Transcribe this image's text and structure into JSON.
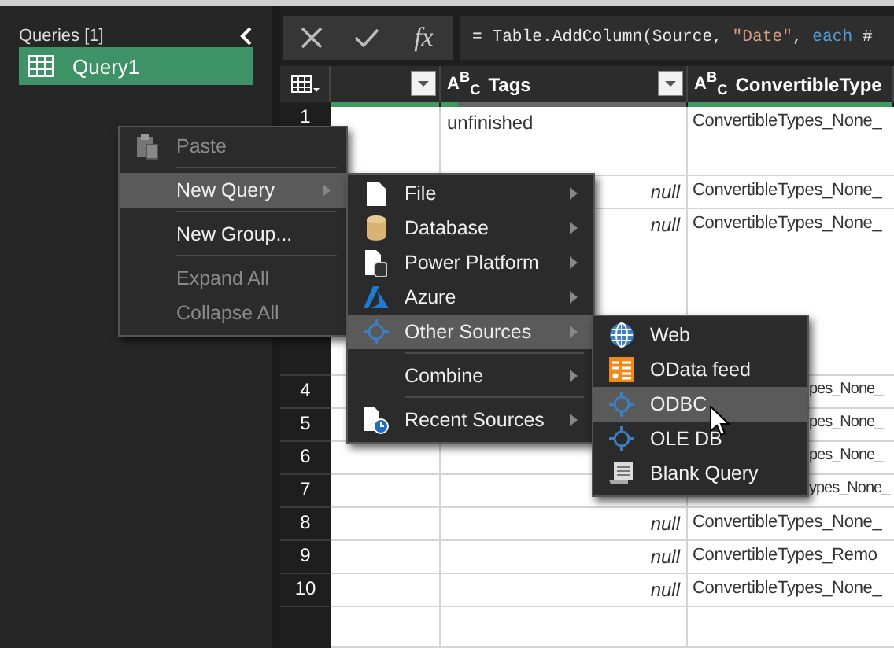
{
  "queries_pane": {
    "title": "Queries [1]",
    "items": [
      {
        "label": "Query1",
        "selected": true
      }
    ]
  },
  "formula_bar": {
    "buttons": [
      {
        "kind": "cancel"
      },
      {
        "kind": "commit"
      },
      {
        "kind": "function",
        "label": "fx"
      }
    ],
    "tokens": [
      {
        "kind": "plain",
        "text": "= Table.AddColumn(Source, "
      },
      {
        "kind": "string",
        "text": "\"Date\""
      },
      {
        "kind": "plain",
        "text": ", "
      },
      {
        "kind": "keyword",
        "text": "each"
      },
      {
        "kind": "plain",
        "text": " #"
      }
    ]
  },
  "table": {
    "columns": [
      {
        "level": 1
      },
      {
        "label": "Tags",
        "type_label": "A$^{B}$$_{C}$",
        "level": 0.07
      },
      {
        "label": "ConvertibleType",
        "type_label": "A$^{B}$$_{C}$",
        "level": 1
      }
    ],
    "rows": [
      {
        "number": "1",
        "tags": "unfinished",
        "tags_is_null": false,
        "convertible": "ConvertibleTypes_None_",
        "partly_hidden": false
      },
      {
        "tags": "null",
        "tags_is_null": true,
        "convertible": "ConvertibleTypes_None_",
        "partly_hidden": false
      },
      {
        "tags": "null",
        "tags_is_null": true,
        "convertible": "ConvertibleTypes_None_",
        "partly_hidden": false
      },
      {
        "number": "4",
        "convertible": "pes_None_",
        "partly_hidden": true
      },
      {
        "number": "5",
        "convertible": "pes_None_",
        "partly_hidden": true
      },
      {
        "number": "6",
        "convertible": "pes_None_",
        "partly_hidden": true
      },
      {
        "number": "7",
        "convertible": "ypes_None_",
        "partly_hidden": true
      },
      {
        "number": "8",
        "tags": "null",
        "tags_is_null": true,
        "convertible": "ConvertibleTypes_None_",
        "partly_hidden": false
      },
      {
        "number": "9",
        "tags": "null",
        "tags_is_null": true,
        "convertible": "ConvertibleTypes_Remo",
        "partly_hidden": false
      },
      {
        "number": "10",
        "tags": "null",
        "tags_is_null": true,
        "convertible": "ConvertibleTypes_None_",
        "partly_hidden": false
      }
    ]
  },
  "context_menu": {
    "items": [
      {
        "kind": "item",
        "label": "Paste",
        "disabled": true,
        "selected": false,
        "submenu": false
      },
      {
        "kind": "separator"
      },
      {
        "kind": "item",
        "label": "New Query",
        "disabled": false,
        "selected": true,
        "submenu": true
      },
      {
        "kind": "separator"
      },
      {
        "kind": "item",
        "label": "New Group...",
        "disabled": false,
        "selected": false,
        "submenu": false
      },
      {
        "kind": "separator"
      },
      {
        "kind": "item",
        "label": "Expand All",
        "disabled": true,
        "selected": false,
        "submenu": false
      },
      {
        "kind": "item",
        "label": "Collapse All",
        "disabled": true,
        "selected": false,
        "submenu": false
      }
    ]
  },
  "new_query_menu": {
    "items": [
      {
        "kind": "item",
        "label": "File",
        "disabled": false,
        "selected": false,
        "submenu": true
      },
      {
        "kind": "item",
        "label": "Database",
        "disabled": false,
        "selected": false,
        "submenu": true
      },
      {
        "kind": "item",
        "label": "Power Platform",
        "disabled": false,
        "selected": false,
        "submenu": true
      },
      {
        "kind": "item",
        "label": "Azure",
        "disabled": false,
        "selected": false,
        "submenu": true
      },
      {
        "kind": "item",
        "label": "Other Sources",
        "disabled": false,
        "selected": true,
        "submenu": true
      },
      {
        "kind": "separator"
      },
      {
        "kind": "item",
        "label": "Combine",
        "disabled": false,
        "selected": false,
        "submenu": true
      },
      {
        "kind": "separator"
      },
      {
        "kind": "item",
        "label": "Recent Sources",
        "disabled": false,
        "selected": false,
        "submenu": true
      }
    ]
  },
  "other_sources_menu": {
    "items": [
      {
        "kind": "item",
        "label": "Web",
        "disabled": false,
        "selected": false,
        "submenu": false
      },
      {
        "kind": "item",
        "label": "OData feed",
        "disabled": false,
        "selected": false,
        "submenu": false
      },
      {
        "kind": "item",
        "label": "ODBC",
        "disabled": false,
        "selected": true,
        "submenu": false
      },
      {
        "kind": "item",
        "label": "OLE DB",
        "disabled": false,
        "selected": false,
        "submenu": false
      },
      {
        "kind": "item",
        "label": "Blank Query",
        "disabled": false,
        "selected": false,
        "submenu": false
      }
    ]
  }
}
